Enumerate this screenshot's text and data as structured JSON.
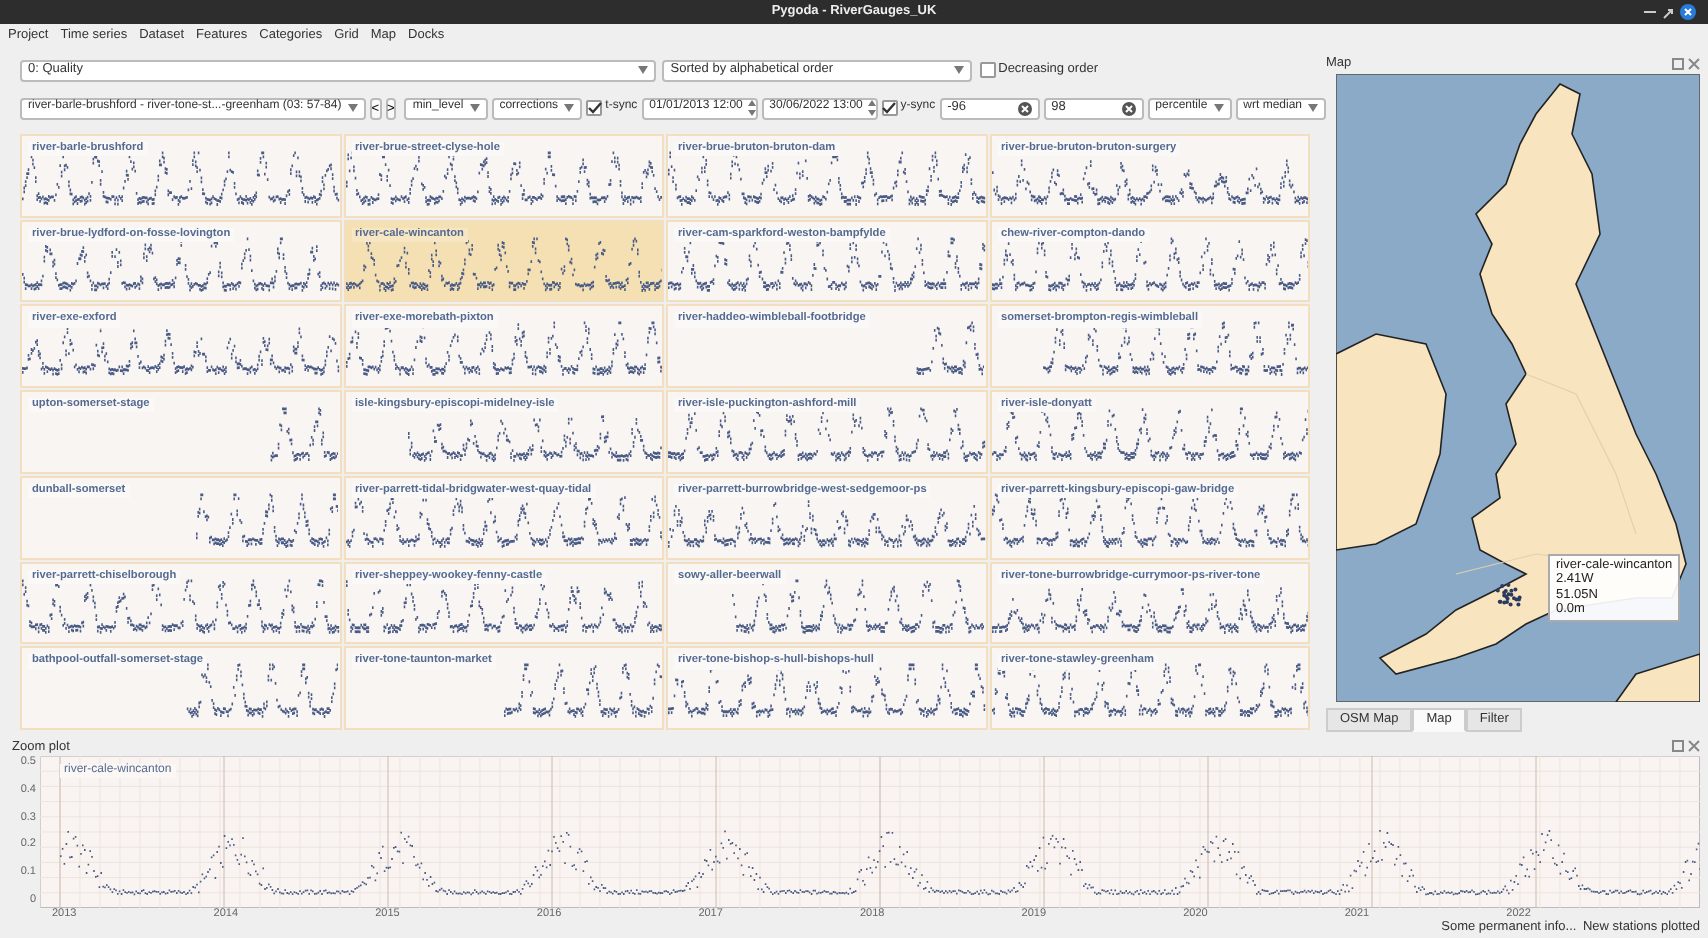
{
  "window": {
    "title": "Pygoda - RiverGauges_UK"
  },
  "menu": [
    "Project",
    "Time series",
    "Dataset",
    "Features",
    "Categories",
    "Grid",
    "Map",
    "Docks"
  ],
  "toolbar": {
    "quality_select": "0: Quality",
    "sort_select": "Sorted by alphabetical order",
    "decreasing_order": {
      "label": "Decreasing order",
      "checked": false
    },
    "station_select": "river-barle-brushford - river-tone-st...-greenham (03: 57-84)",
    "prev_button": "<",
    "next_button": ">",
    "feature_select": "min_level",
    "corrections_select": "corrections",
    "t_sync": {
      "label": "t-sync",
      "checked": true
    },
    "start_time": "01/01/2013 12:00",
    "end_time": "30/06/2022 13:00",
    "y_sync": {
      "label": "y-sync",
      "checked": true
    },
    "y_min": "-96",
    "y_max": "98",
    "scale_select": "percentile",
    "reference_select": "wrt median"
  },
  "grid": {
    "tiles": [
      {
        "name": "river-barle-brushford",
        "selected": false
      },
      {
        "name": "river-brue-street-clyse-hole",
        "selected": false
      },
      {
        "name": "river-brue-bruton-bruton-dam",
        "selected": false
      },
      {
        "name": "river-brue-bruton-bruton-surgery",
        "selected": false
      },
      {
        "name": "river-brue-lydford-on-fosse-lovington",
        "selected": false
      },
      {
        "name": "river-cale-wincanton",
        "selected": true
      },
      {
        "name": "river-cam-sparkford-weston-bampfylde",
        "selected": false
      },
      {
        "name": "chew-river-compton-dando",
        "selected": false
      },
      {
        "name": "river-exe-exford",
        "selected": false
      },
      {
        "name": "river-exe-morebath-pixton",
        "selected": false
      },
      {
        "name": "river-haddeo-wimbleball-footbridge",
        "selected": false
      },
      {
        "name": "somerset-brompton-regis-wimbleball",
        "selected": false
      },
      {
        "name": "upton-somerset-stage",
        "selected": false
      },
      {
        "name": "isle-kingsbury-episcopi-midelney-isle",
        "selected": false
      },
      {
        "name": "river-isle-puckington-ashford-mill",
        "selected": false
      },
      {
        "name": "river-isle-donyatt",
        "selected": false
      },
      {
        "name": "dunball-somerset",
        "selected": false
      },
      {
        "name": "river-parrett-tidal-bridgwater-west-quay-tidal",
        "selected": false
      },
      {
        "name": "river-parrett-burrowbridge-west-sedgemoor-ps",
        "selected": false
      },
      {
        "name": "river-parrett-kingsbury-episcopi-gaw-bridge",
        "selected": false
      },
      {
        "name": "river-parrett-chiselborough",
        "selected": false
      },
      {
        "name": "river-sheppey-wookey-fenny-castle",
        "selected": false
      },
      {
        "name": "sowy-aller-beerwall",
        "selected": false
      },
      {
        "name": "river-tone-burrowbridge-currymoor-ps-river-tone",
        "selected": false
      },
      {
        "name": "bathpool-outfall-somerset-stage",
        "selected": false
      },
      {
        "name": "river-tone-taunton-market",
        "selected": false
      },
      {
        "name": "river-tone-bishop-s-hull-bishops-hull",
        "selected": false
      },
      {
        "name": "river-tone-stawley-greenham",
        "selected": false
      }
    ]
  },
  "map_dock": {
    "title": "Map",
    "tooltip": [
      "river-cale-wincanton",
      "2.41W",
      "51.05N",
      "0.0m"
    ],
    "tabs": [
      {
        "label": "OSM Map",
        "selected": false
      },
      {
        "label": "Map",
        "selected": true
      },
      {
        "label": "Filter",
        "selected": false
      }
    ]
  },
  "zoom_plot": {
    "title": "Zoom plot",
    "series_label": "river-cale-wincanton",
    "y_tick_labels": [
      "0.5",
      "0.4",
      "0.3",
      "0.2",
      "0.1",
      "0"
    ],
    "x_tick_labels": [
      "2013",
      "2014",
      "2015",
      "2016",
      "2017",
      "2018",
      "2019",
      "2020",
      "2021",
      "2022"
    ]
  },
  "status_bar": [
    "Some permanent info...",
    "New stations plotted"
  ]
}
